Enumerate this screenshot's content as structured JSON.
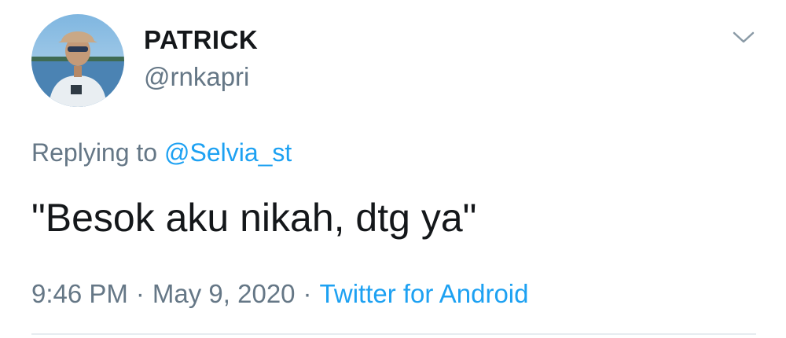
{
  "author": {
    "display_name": "PATRICK",
    "handle": "@rnkapri"
  },
  "reply": {
    "prefix": "Replying to",
    "mention": "@Selvia_st"
  },
  "tweet": {
    "text": "\"Besok aku nikah, dtg ya\""
  },
  "meta": {
    "time": "9:46 PM",
    "separator": "·",
    "date": "May 9, 2020",
    "source": "Twitter for Android"
  },
  "icons": {
    "menu": "chevron-down-icon",
    "avatar": "profile-photo"
  },
  "colors": {
    "text_primary": "#14171a",
    "text_secondary": "#657786",
    "link": "#1da1f2",
    "divider": "#e6ecf0"
  }
}
